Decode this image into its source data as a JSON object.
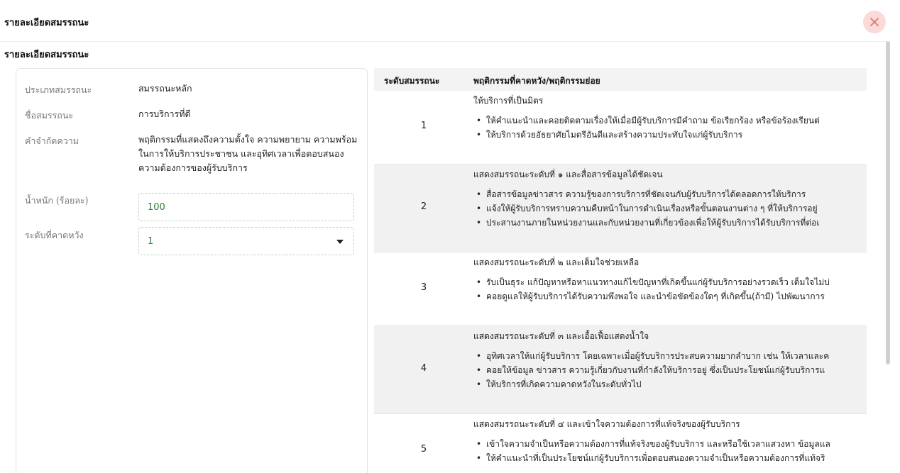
{
  "modal": {
    "title": "รายละเอียดสมรรถนะ",
    "close_icon": "close-icon"
  },
  "section": {
    "title": "รายละเอียดสมรรถนะ"
  },
  "info": {
    "type_label": "ประเภทสมรรถนะ",
    "type_value": "สมรรถนะหลัก",
    "name_label": "ชื่อสมรรถนะ",
    "name_value": "การบริการที่ดี",
    "definition_label": "คำจำกัดความ",
    "definition_value": "พฤติกรรมที่แสดงถึงความตั้งใจ ความพยายาม ความพร้อมในการให้บริการประชาชน และอุทิศเวลาเพื่อตอบสนองความต้องการของผู้รับบริการ",
    "weight_label": "น้ำหนัก (ร้อยละ)",
    "weight_value": "100",
    "expected_label": "ระดับที่คาดหวัง",
    "expected_value": "1"
  },
  "table": {
    "col_level": "ระดับสมรรถนะ",
    "col_behavior": "พฤติกรรมที่คาดหวัง/พฤติกรรมย่อย",
    "rows": [
      {
        "level": "1",
        "lead": "ให้บริการที่เป็นมิตร",
        "items": [
          "ให้คำแนะนำและคอยติดตามเรื่องให้เมื่อมีผู้รับบริการมีคำถาม ข้อเรียกร้อง หรือข้อร้องเรียนต่",
          "ให้บริการด้วยอัธยาศัยไมตรีอันดีและสร้างความประทับใจแก่ผู้รับบริการ"
        ]
      },
      {
        "level": "2",
        "lead": "แสดงสมรรถนะระดับที่ ๑ และสื่อสารข้อมูลได้ชัดเจน",
        "items": [
          "สื่อสารข้อมูลข่าวสาร ความรู้ของการบริการที่ชัดเจนกับผู้รับบริการได้ตลอดการให้บริการ",
          "แจ้งให้ผู้รับบริการทราบความคืบหน้าในการดำเนินเรื่องหรือขั้นตอนงานต่าง ๆ ที่ให้บริการอยู่",
          "ประสานงานภายในหน่วยงานและกับหน่วยงานที่เกี่ยวข้องเพื่อให้ผู้รับบริการได้รับบริการที่ต่อเ"
        ]
      },
      {
        "level": "3",
        "lead": "แสดงสมรรถนะระดับที่ ๒ และเต็มใจช่วยเหลือ",
        "items": [
          "รับเป็นธุระ แก้ปัญหาหรือหาแนวทางแก้ไขปัญหาที่เกิดขึ้นแก่ผู้รับบริการอย่างรวดเร็ว เต็มใจไม่บ่",
          "คอยดูแลให้ผู้รับบริการได้รับความพึงพอใจ และนำข้อขัดข้องใดๆ ที่เกิดขึ้น(ถ้ามี) ไปพัฒนาการ"
        ]
      },
      {
        "level": "4",
        "lead": "แสดงสมรรถนะระดับที่ ๓ และเอื้อเฟื้อแสดงน้ำใจ",
        "items": [
          "อุทิศเวลาให้แก่ผู้รับบริการ โดยเฉพาะเมื่อผู้รับบริการประสบความยากลำบาก เช่น ให้เวลาและค",
          "คอยให้ข้อมูล ข่าวสาร ความรู้เกี่ยวกับงานที่กำลังให้บริการอยู่ ซึ่งเป็นประโยชน์แก่ผู้รับบริการแ",
          "ให้บริการที่เกิดความคาดหวังในระดับทั่วไป"
        ]
      },
      {
        "level": "5",
        "lead": "แสดงสมรรถนะระดับที่ ๔ และเข้าใจความต้องการที่แท้จริงของผู้รับบริการ",
        "items": [
          "เข้าใจความจำเป็นหรือความต้องการที่แท้จริงของผู้รับบริการ และหรือใช้เวลาแสวงหา ข้อมูลแล",
          "ให้คำแนะนำที่เป็นประโยชน์แก่ผู้รับบริการเพื่อตอบสนองความจำเป็นหรือความต้องการที่แท้จริ"
        ]
      }
    ]
  }
}
